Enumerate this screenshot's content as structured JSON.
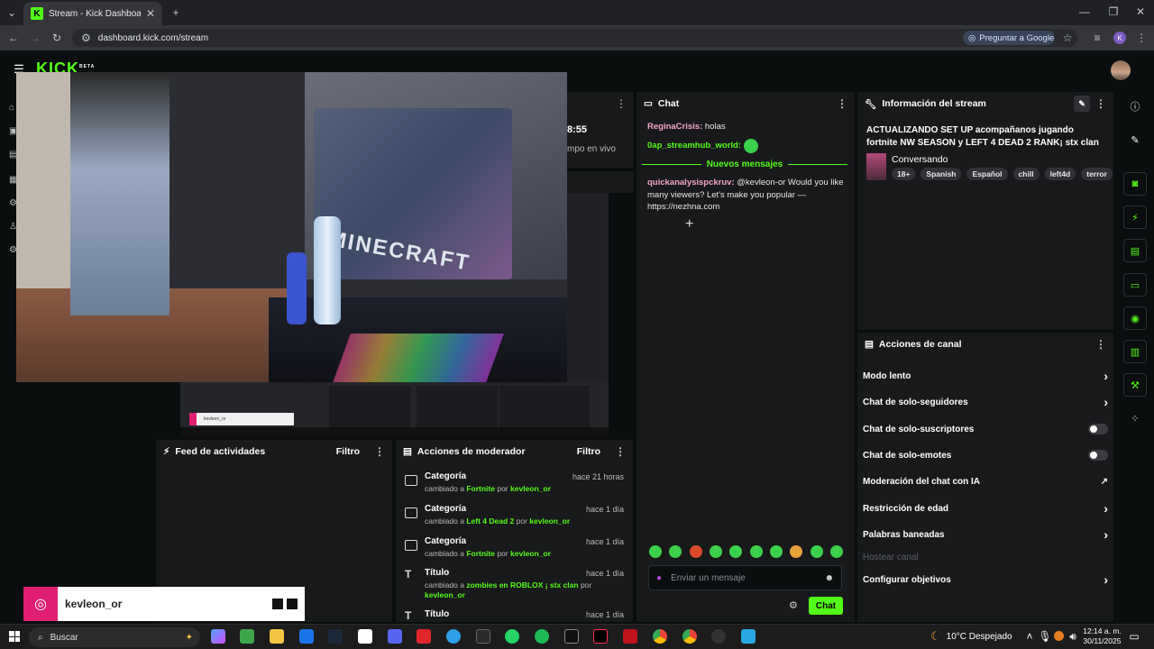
{
  "browser": {
    "tab_title": "Stream - Kick Dashboard",
    "url": "dashboard.kick.com/stream",
    "ask_google": "Preguntar a Google",
    "profile_initial": "K"
  },
  "kick": {
    "logo": "KICK",
    "logo_badge": "BETA"
  },
  "stream_panel": {
    "time": "8:55",
    "subtext": "mpo en vivo"
  },
  "chat": {
    "title": "Chat",
    "messages": [
      {
        "user": "ReginaCrisis",
        "text": "holas"
      },
      {
        "user": "0ap_streamhub_world",
        "text": ""
      },
      {
        "user": "quickanalysispckruv",
        "text": "@kevleon-or Would you like many viewers? Let's make you popular — https://nezhna.com"
      }
    ],
    "new_messages": "Nuevos mensajes",
    "input_placeholder": "Enviar un mensaje",
    "send_label": "Chat"
  },
  "stream_info": {
    "title": "Información del stream",
    "stream_title": "ACTUALIZANDO SET UP acompañanos jugando fortnite NW SEASON y LEFT 4 DEAD 2 RANK¡ stx clan",
    "category": "Conversando",
    "tags": [
      "18+",
      "Spanish",
      "Español",
      "chill",
      "left4d",
      "terror"
    ]
  },
  "channel_actions": {
    "title": "Acciones de canal",
    "items": [
      {
        "label": "Modo lento",
        "control": "chevron"
      },
      {
        "label": "Chat de solo-seguidores",
        "control": "chevron"
      },
      {
        "label": "Chat de solo-suscriptores",
        "control": "toggle"
      },
      {
        "label": "Chat de solo-emotes",
        "control": "toggle"
      },
      {
        "label": "Moderación del chat con IA",
        "control": "external"
      },
      {
        "label": "Restricción de edad",
        "control": "chevron"
      },
      {
        "label": "Palabras baneadas",
        "control": "chevron"
      },
      {
        "label": "Hostear canal",
        "control": "none"
      },
      {
        "label": "Configurar objetivos",
        "control": "chevron"
      }
    ]
  },
  "activity_feed": {
    "title": "Feed de actividades",
    "filter": "Filtro"
  },
  "mod_actions": {
    "title": "Acciones de moderador",
    "filter": "Filtro",
    "by": "por",
    "changed_to": "cambiado a",
    "rows": [
      {
        "kind": "Categoría",
        "time": "hace 21 horas",
        "value": "Fortnite",
        "user": "kevleon_or"
      },
      {
        "kind": "Categoría",
        "time": "hace 1 día",
        "value": "Left 4 Dead 2",
        "user": "kevleon_or"
      },
      {
        "kind": "Categoría",
        "time": "hace 1 día",
        "value": "Fortnite",
        "user": "kevleon_or"
      },
      {
        "kind": "Título",
        "time": "hace 1 día",
        "value": "zombies en ROBLOX ¡ stx clan",
        "user": "kevleon_or"
      },
      {
        "kind": "Título",
        "time": "hace 1 día",
        "value": "",
        "user": ""
      }
    ]
  },
  "video_overlay": {
    "screen_text": "MINECRAFT",
    "ig_handle": "kevleon_or"
  },
  "taskbar": {
    "search": "Buscar",
    "weather": "10°C  Despejado",
    "time": "12:14 a. m.",
    "date": "30/11/2025"
  }
}
